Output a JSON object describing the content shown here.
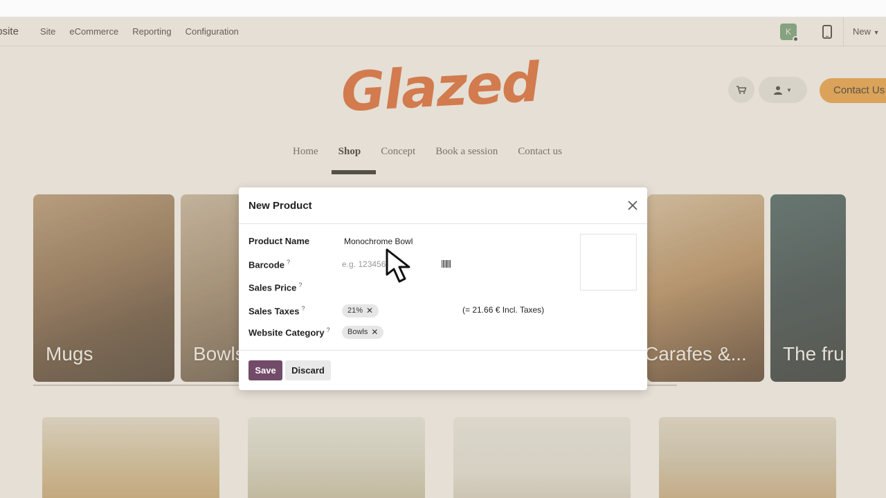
{
  "admin_bar": {
    "app_name": "Website",
    "menu": [
      "Site",
      "eCommerce",
      "Reporting",
      "Configuration"
    ],
    "avatar_letter": "K",
    "new_label": "New"
  },
  "site": {
    "logo_text": "Glazed",
    "contact_label": "Contact Us",
    "nav": [
      "Home",
      "Shop",
      "Concept",
      "Book a session",
      "Contact us"
    ],
    "active_nav": "Shop"
  },
  "categories": [
    {
      "label": "Mugs"
    },
    {
      "label": "Bowls"
    },
    {
      "label": "Carafes &..."
    },
    {
      "label": "The fru"
    }
  ],
  "modal": {
    "title": "New Product",
    "fields": {
      "product_name_label": "Product Name",
      "product_name_value": "Monochrome Bowl",
      "barcode_label": "Barcode",
      "barcode_placeholder": "e.g. 1234567890",
      "sales_price_label": "Sales Price",
      "sales_taxes_label": "Sales Taxes",
      "sales_taxes_tag": "21%",
      "incl_taxes": "(= 21.66 € Incl. Taxes)",
      "website_category_label": "Website Category",
      "website_category_tag": "Bowls",
      "help_mark": "?"
    },
    "save_label": "Save",
    "discard_label": "Discard"
  },
  "colors": {
    "primary": "#714b67",
    "logo": "#e2612b",
    "contact_button": "#f0a03e"
  }
}
